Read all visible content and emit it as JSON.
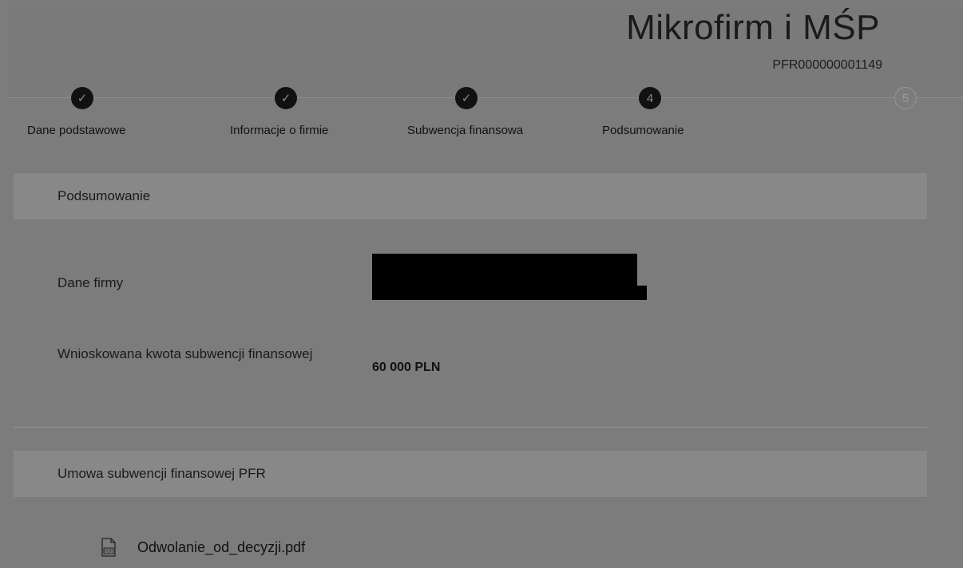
{
  "header": {
    "title": "Mikrofirm i MŚP",
    "reference": "PFR000000001149"
  },
  "stepper": {
    "steps": [
      {
        "label": "Dane podstawowe",
        "state": "done",
        "marker": "✓"
      },
      {
        "label": "Informacje o firmie",
        "state": "done",
        "marker": "✓"
      },
      {
        "label": "Subwencja finansowa",
        "state": "done",
        "marker": "✓"
      },
      {
        "label": "Podsumowanie",
        "state": "current",
        "marker": "4"
      },
      {
        "label": "",
        "state": "pending",
        "marker": "5"
      }
    ]
  },
  "summary": {
    "heading": "Podsumowanie",
    "company_label": "Dane firmy",
    "company_value": "[redacted]",
    "amount_label": "Wnioskowana kwota subwencji finansowej",
    "amount_value": "60 000 PLN"
  },
  "agreement": {
    "heading": "Umowa subwencji finansowej PFR",
    "file_name": "Odwolanie_od_decyzji.pdf",
    "file_icon": "pdf-file-icon"
  }
}
